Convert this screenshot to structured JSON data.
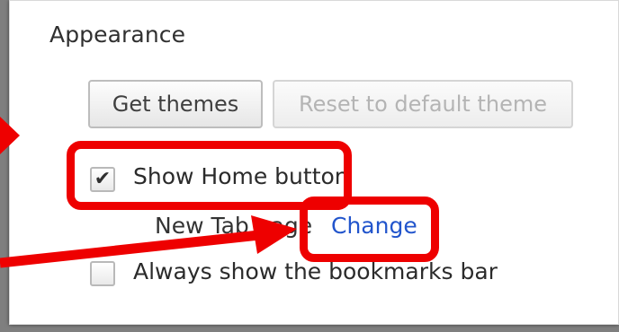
{
  "appearance": {
    "title": "Appearance",
    "get_themes_label": "Get themes",
    "reset_theme_label": "Reset to default theme",
    "show_home_button": {
      "label": "Show Home button",
      "checked": true,
      "check_glyph": "✔"
    },
    "home_page": {
      "label": "New Tab page",
      "change_link": "Change"
    },
    "bookmarks_bar": {
      "label": "Always show the bookmarks bar",
      "checked": false
    }
  },
  "annotations": {
    "highlight_color": "#ee0000"
  }
}
